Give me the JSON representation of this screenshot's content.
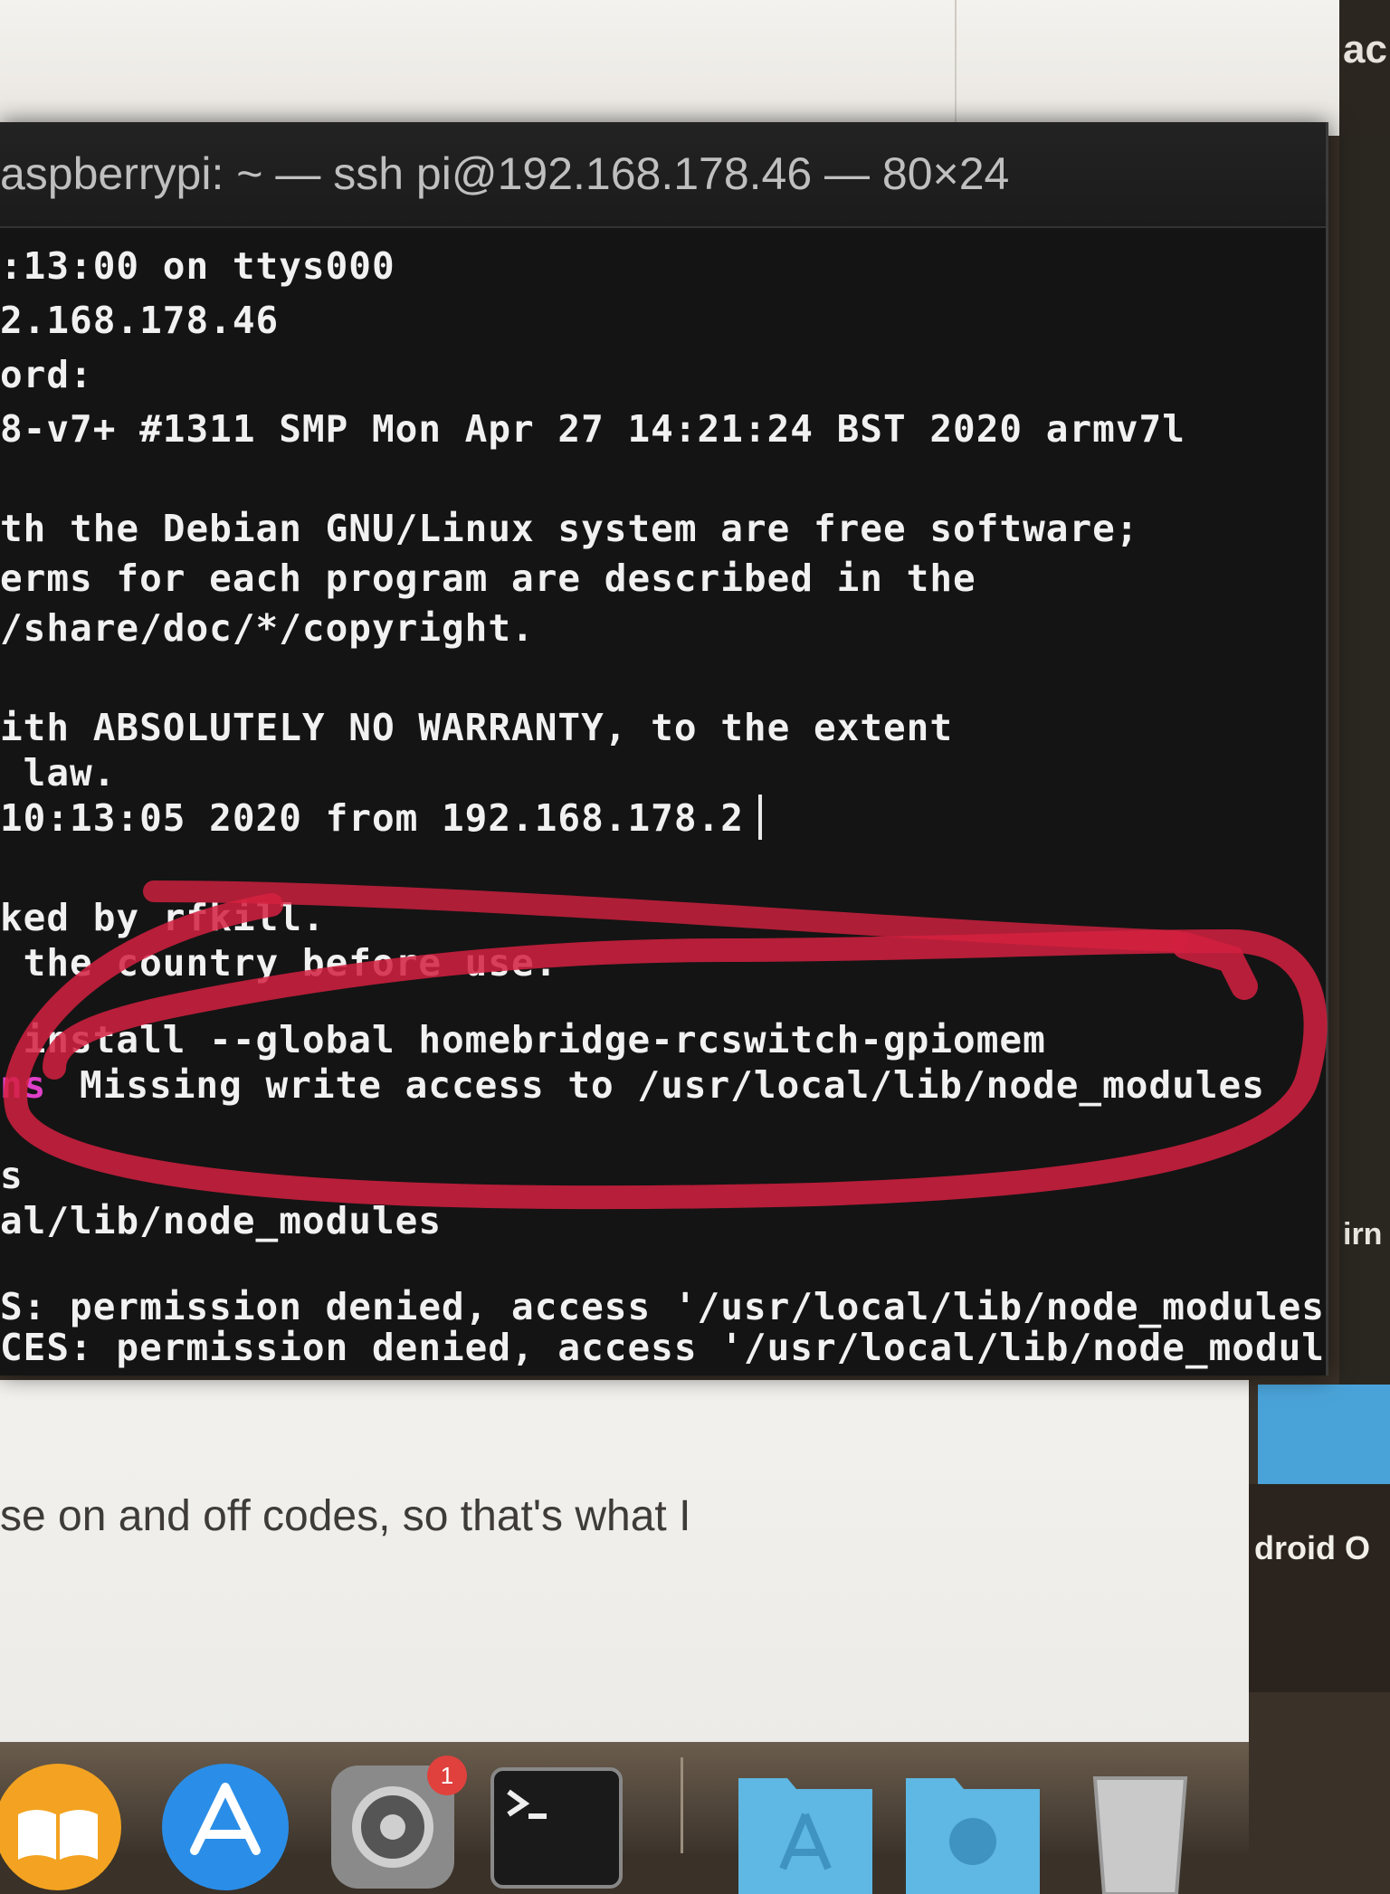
{
  "background": {
    "top_right_text": "ac",
    "right_label_1": "irn",
    "right_label_2": "droid O",
    "browser_text": "se on and off codes, so that's what I"
  },
  "terminal": {
    "title": "aspberrypi: ~ — ssh pi@192.168.178.46 — 80×24",
    "lines": [
      ":13:00 on ttys000",
      "2.168.178.46",
      "ord:",
      "8-v7+ #1311 SMP Mon Apr 27 14:21:24 BST 2020 armv7l",
      "",
      "th the Debian GNU/Linux system are free software;",
      "erms for each program are described in the",
      "/share/doc/*/copyright.",
      "",
      "ith ABSOLUTELY NO WARRANTY, to the extent",
      " law.",
      "10:13:05 2020 from 192.168.178.2",
      "",
      "ked by rfkill.",
      " the country before use.",
      "",
      " install --global homebridge-rcswitch-gpiomem",
      "Missing write access to /usr/local/lib/node_modules",
      "",
      "s",
      "al/lib/node_modules",
      "",
      "S: permission denied, access '/usr/local/lib/node_modules'",
      "CES: permission denied, access '/usr/local/lib/node_modules"
    ],
    "magenta_prefix": "ns"
  },
  "dock": {
    "badge_count": "1",
    "icons": [
      "books-icon",
      "app-store-icon",
      "system-preferences-icon",
      "terminal-icon",
      "applications-folder-icon",
      "downloads-folder-icon",
      "trash-icon"
    ]
  },
  "colors": {
    "annotation_red": "#d42040",
    "terminal_bg": "#141414",
    "terminal_fg": "#f1f1f1",
    "npm_warn_magenta": "#e040c8"
  }
}
